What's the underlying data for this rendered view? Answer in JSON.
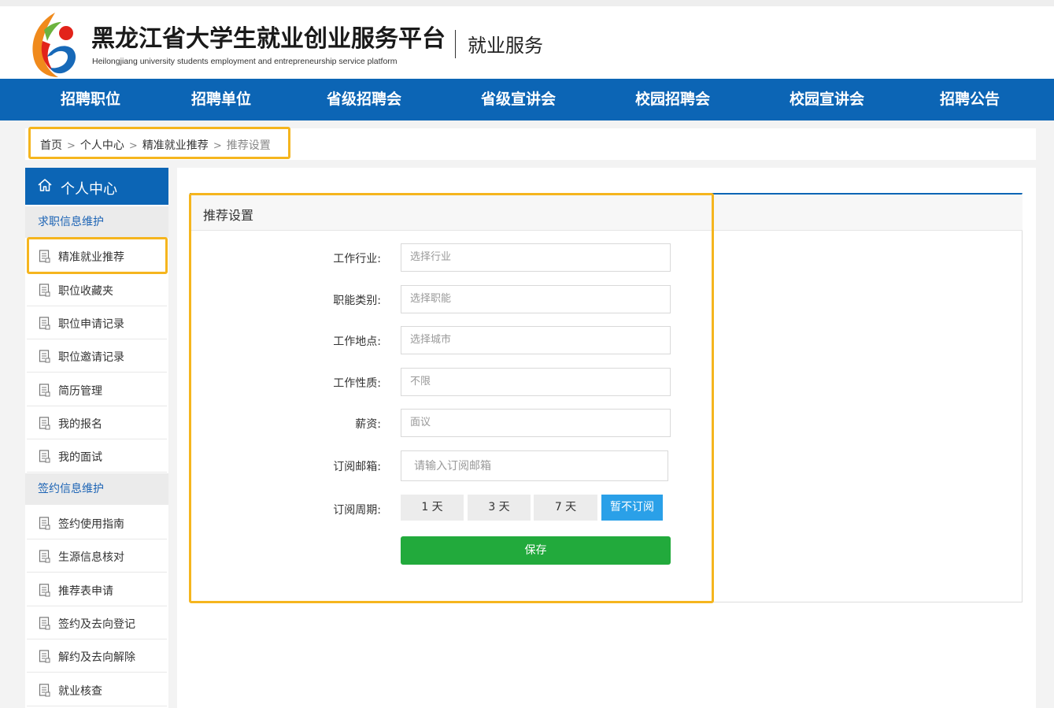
{
  "header": {
    "title": "黑龙江省大学生就业创业服务平台",
    "subtitle": "Heilongjiang university students employment and entrepreneurship service platform",
    "section": "就业服务"
  },
  "nav": [
    "招聘职位",
    "招聘单位",
    "省级招聘会",
    "省级宣讲会",
    "校园招聘会",
    "校园宣讲会",
    "招聘公告"
  ],
  "breadcrumb": {
    "items": [
      "首页",
      "个人中心",
      "精准就业推荐"
    ],
    "current": "推荐设置",
    "separator": ">"
  },
  "sidebar": {
    "title": "个人中心",
    "group1": "求职信息维护",
    "items1": [
      "精准就业推荐",
      "职位收藏夹",
      "职位申请记录",
      "职位邀请记录",
      "简历管理",
      "我的报名",
      "我的面试"
    ],
    "group2": "签约信息维护",
    "items2": [
      "签约使用指南",
      "生源信息核对",
      "推荐表申请",
      "签约及去向登记",
      "解约及去向解除",
      "就业核查"
    ]
  },
  "form": {
    "title": "推荐设置",
    "industry_label": "工作行业:",
    "industry_value": "选择行业",
    "function_label": "职能类别:",
    "function_value": "选择职能",
    "location_label": "工作地点:",
    "location_value": "选择城市",
    "nature_label": "工作性质:",
    "nature_value": "不限",
    "salary_label": "薪资:",
    "salary_value": "面议",
    "email_label": "订阅邮箱:",
    "email_placeholder": "请输入订阅邮箱",
    "period_label": "订阅周期:",
    "periods": [
      "1 天",
      "3 天",
      "7 天",
      "暂不订阅"
    ],
    "period_selected": "暂不订阅",
    "save_label": "保存"
  },
  "colors": {
    "brand_blue": "#0c65b5",
    "highlight": "#f5b51e",
    "save_green": "#22aa3c",
    "selected_period": "#2aa0e8"
  }
}
